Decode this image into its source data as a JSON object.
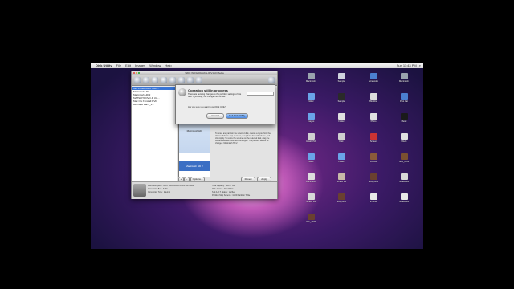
{
  "menubar": {
    "apple_icon": "apple-icon",
    "items": [
      "Disk Utility",
      "File",
      "Edit",
      "Images",
      "Window",
      "Help"
    ],
    "clock": "Sun 11:43 PM"
  },
  "window": {
    "title": "WDC WD3200AAKS-00V1A0 Media",
    "toolbar": [
      "Burn",
      "Verify",
      "Info",
      "Eject",
      "Enable Journaling",
      "New Image",
      "Convert",
      "Resize Image",
      "Log"
    ],
    "sidebar": [
      {
        "label": "320.07 GB WDC WD3...",
        "selected": true
      },
      {
        "label": "Macintosh HD",
        "selected": false
      },
      {
        "label": "Macintosh HD 2",
        "selected": false
      },
      {
        "label": "MATSHITA DVD-R UJ-...",
        "selected": false
      },
      {
        "label": "Mac OS X Install DVD",
        "selected": false
      },
      {
        "label": "Reimage Part1_3...",
        "selected": false
      }
    ],
    "partition": {
      "slice1": "Macintosh HD",
      "slice2": "Macintosh HD 2"
    },
    "info_text": "To erase and partition the selected disk, choose a layout from the Volume Scheme pop-up menu, set options for each volume, and click Apply. To resize the volumes on the selected disk, drag the dividers between them and click Apply. This partition will not be changed. Macintosh HD 2",
    "buttons": {
      "revert": "Revert",
      "apply": "Apply",
      "add": "+",
      "remove": "−",
      "options": "Options..."
    },
    "bottom": {
      "left": [
        "Disk Description : WDC WD3200AAKS-00V1A0 Media",
        "Connection Bus : SATA",
        "Connection Type : Internal"
      ],
      "right": [
        "Total Capacity : 320.07 GB",
        "Write Status : Read/Write",
        "S.M.A.R.T. Status : Verified",
        "Partition Map Scheme : GUID Partition Table"
      ]
    }
  },
  "sheet": {
    "heading": "Operation still in progress",
    "body": "There are pending changes to the partition settings of this disk. If you stop, the changes will be lost.",
    "question": "Are you sure you want to quit Disk Utility?",
    "cancel": "Cancel",
    "quit": "Quit Disk Utility"
  },
  "desktop_icons": [
    {
      "label": "Macintosh HD",
      "color": "#9aa3ad"
    },
    {
      "label": "Sample",
      "color": "#cfd3dd"
    },
    {
      "label": "Screenshot",
      "color": "#4b7fd1"
    },
    {
      "label": "Macintosh HD",
      "color": "#9aa3ad"
    },
    {
      "label": "Folder",
      "color": "#6aa4e8"
    },
    {
      "label": "Sample",
      "color": "#2a2a2a"
    },
    {
      "label": "Blocklist",
      "color": "#dcdcdc"
    },
    {
      "label": "Post Cat",
      "color": "#4b7fd1"
    },
    {
      "label": "Images",
      "color": "#6aa4e8"
    },
    {
      "label": "Folder",
      "color": "#e0e0e0"
    },
    {
      "label": "Photo",
      "color": "#e0e0e0"
    },
    {
      "label": "Music",
      "color": "#1a1a1a"
    },
    {
      "label": "Install DVD",
      "color": "#d0d0d0"
    },
    {
      "label": "Disk",
      "color": "#cfcfcf"
    },
    {
      "label": "Screen",
      "color": "#cc3333"
    },
    {
      "label": "Movie",
      "color": "#e0e0e0"
    },
    {
      "label": "Folder",
      "color": "#6aa4e8"
    },
    {
      "label": "Folder",
      "color": "#6aa4e8"
    },
    {
      "label": "Picture",
      "color": "#8a5a3a"
    },
    {
      "label": "IMG_2003.JPG",
      "color": "#7a5030"
    },
    {
      "label": "Document",
      "color": "#dddddd"
    },
    {
      "label": "Screen shot",
      "color": "#c8b8a8"
    },
    {
      "label": "IMG_2004.JPG",
      "color": "#6a4030"
    },
    {
      "label": "Screen shot",
      "color": "#d8d8d8"
    },
    {
      "label": "Screen shot",
      "color": "#d8d8d8"
    },
    {
      "label": "IMG_2005.JPG",
      "color": "#6a4030"
    },
    {
      "label": "iPhone",
      "color": "#e8e8e8"
    },
    {
      "label": "Screen shot",
      "color": "#e8e8e8"
    },
    {
      "label": "IMG_2006.JPG",
      "color": "#6a4030"
    }
  ]
}
